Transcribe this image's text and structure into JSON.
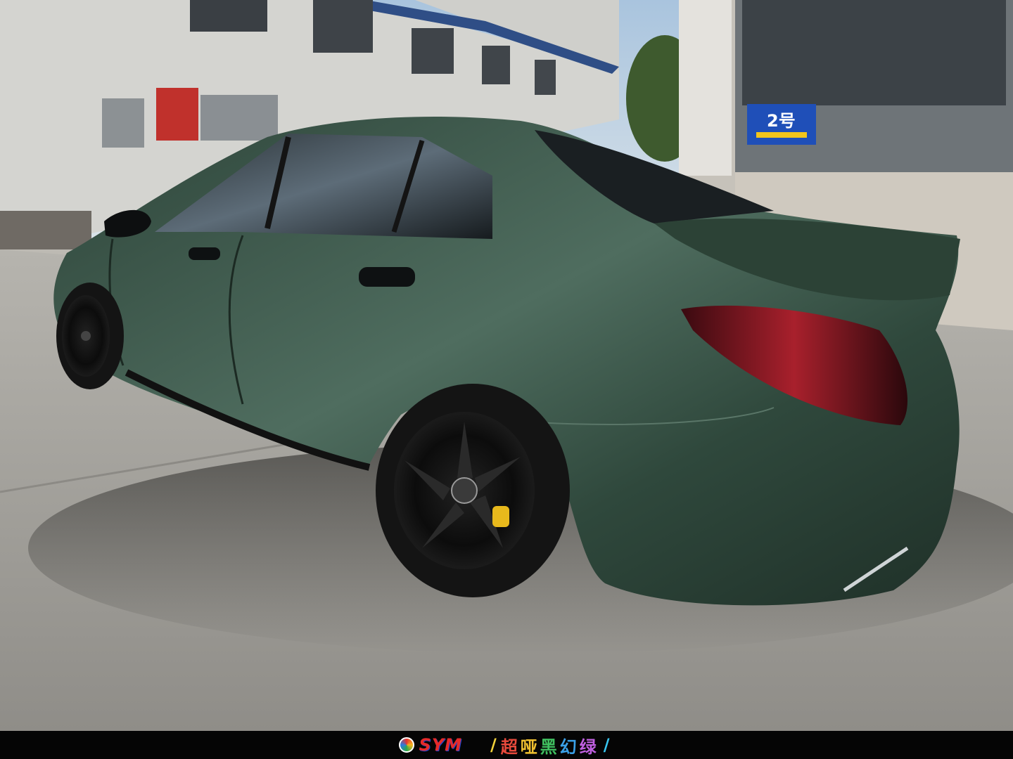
{
  "scene": {
    "subject": "car-matte-green-sedan",
    "colors": {
      "car_body": "#2f463b",
      "car_highlight": "#5a7668",
      "ground": "#a9a7a1",
      "building_left": "#cfcfcb",
      "building_right": "#c8c4bc",
      "sky": "#b8cfe3",
      "sign_blue": "#1f4fb8",
      "tail_light": "#8a1620"
    },
    "sign_text": "2号"
  },
  "footer": {
    "brand": "SYM",
    "caption_chars": [
      "超",
      "哑",
      "黑",
      "幻",
      "绿"
    ],
    "caption_colors": [
      "#e84a3c",
      "#f0c030",
      "#40c060",
      "#3aa0e8",
      "#c060e0"
    ],
    "slash_left": "/",
    "slash_right": "/"
  }
}
